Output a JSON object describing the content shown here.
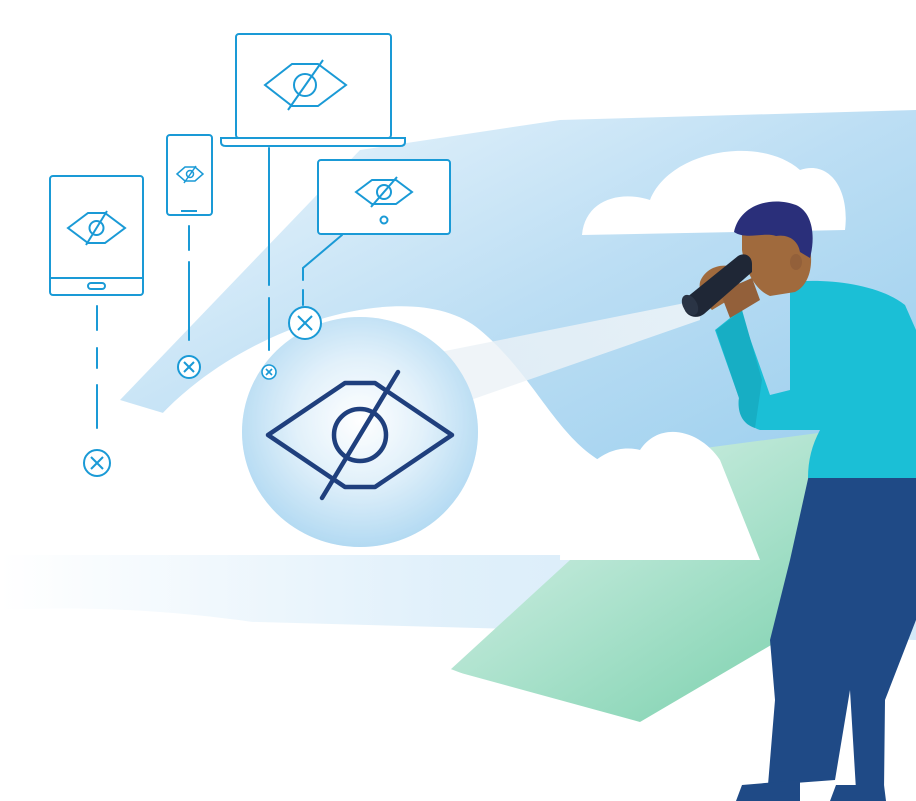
{
  "scene": {
    "name": "privacy-hidden-devices-illustration"
  },
  "colors": {
    "background": "#ffffff",
    "sky_light": "#e3f1fb",
    "sky_mid": "#b9dcf2",
    "sky_deep": "#8ec8ec",
    "ground_green_light": "#d4f0e4",
    "ground_green": "#74cfa9",
    "cloud": "#ffffff",
    "line_blue": "#1a9ad6",
    "eye_dark_navy": "#1f3f7d",
    "beam": "#e4eef5",
    "spotlight_light": "#ffffff",
    "spotlight_mid": "#9fd0ee",
    "skin": "#a06a3d",
    "hair": "#2a2f7a",
    "shirt": "#1bbfd6",
    "pants": "#1f4a86",
    "binoculars": "#1f2736"
  },
  "icons": {
    "device_icon": "eye-slash-icon",
    "blocked_marker": "close-circle-icon",
    "central_icon": "eye-slash-icon"
  },
  "devices": [
    "tablet",
    "phone",
    "laptop",
    "monitor"
  ]
}
